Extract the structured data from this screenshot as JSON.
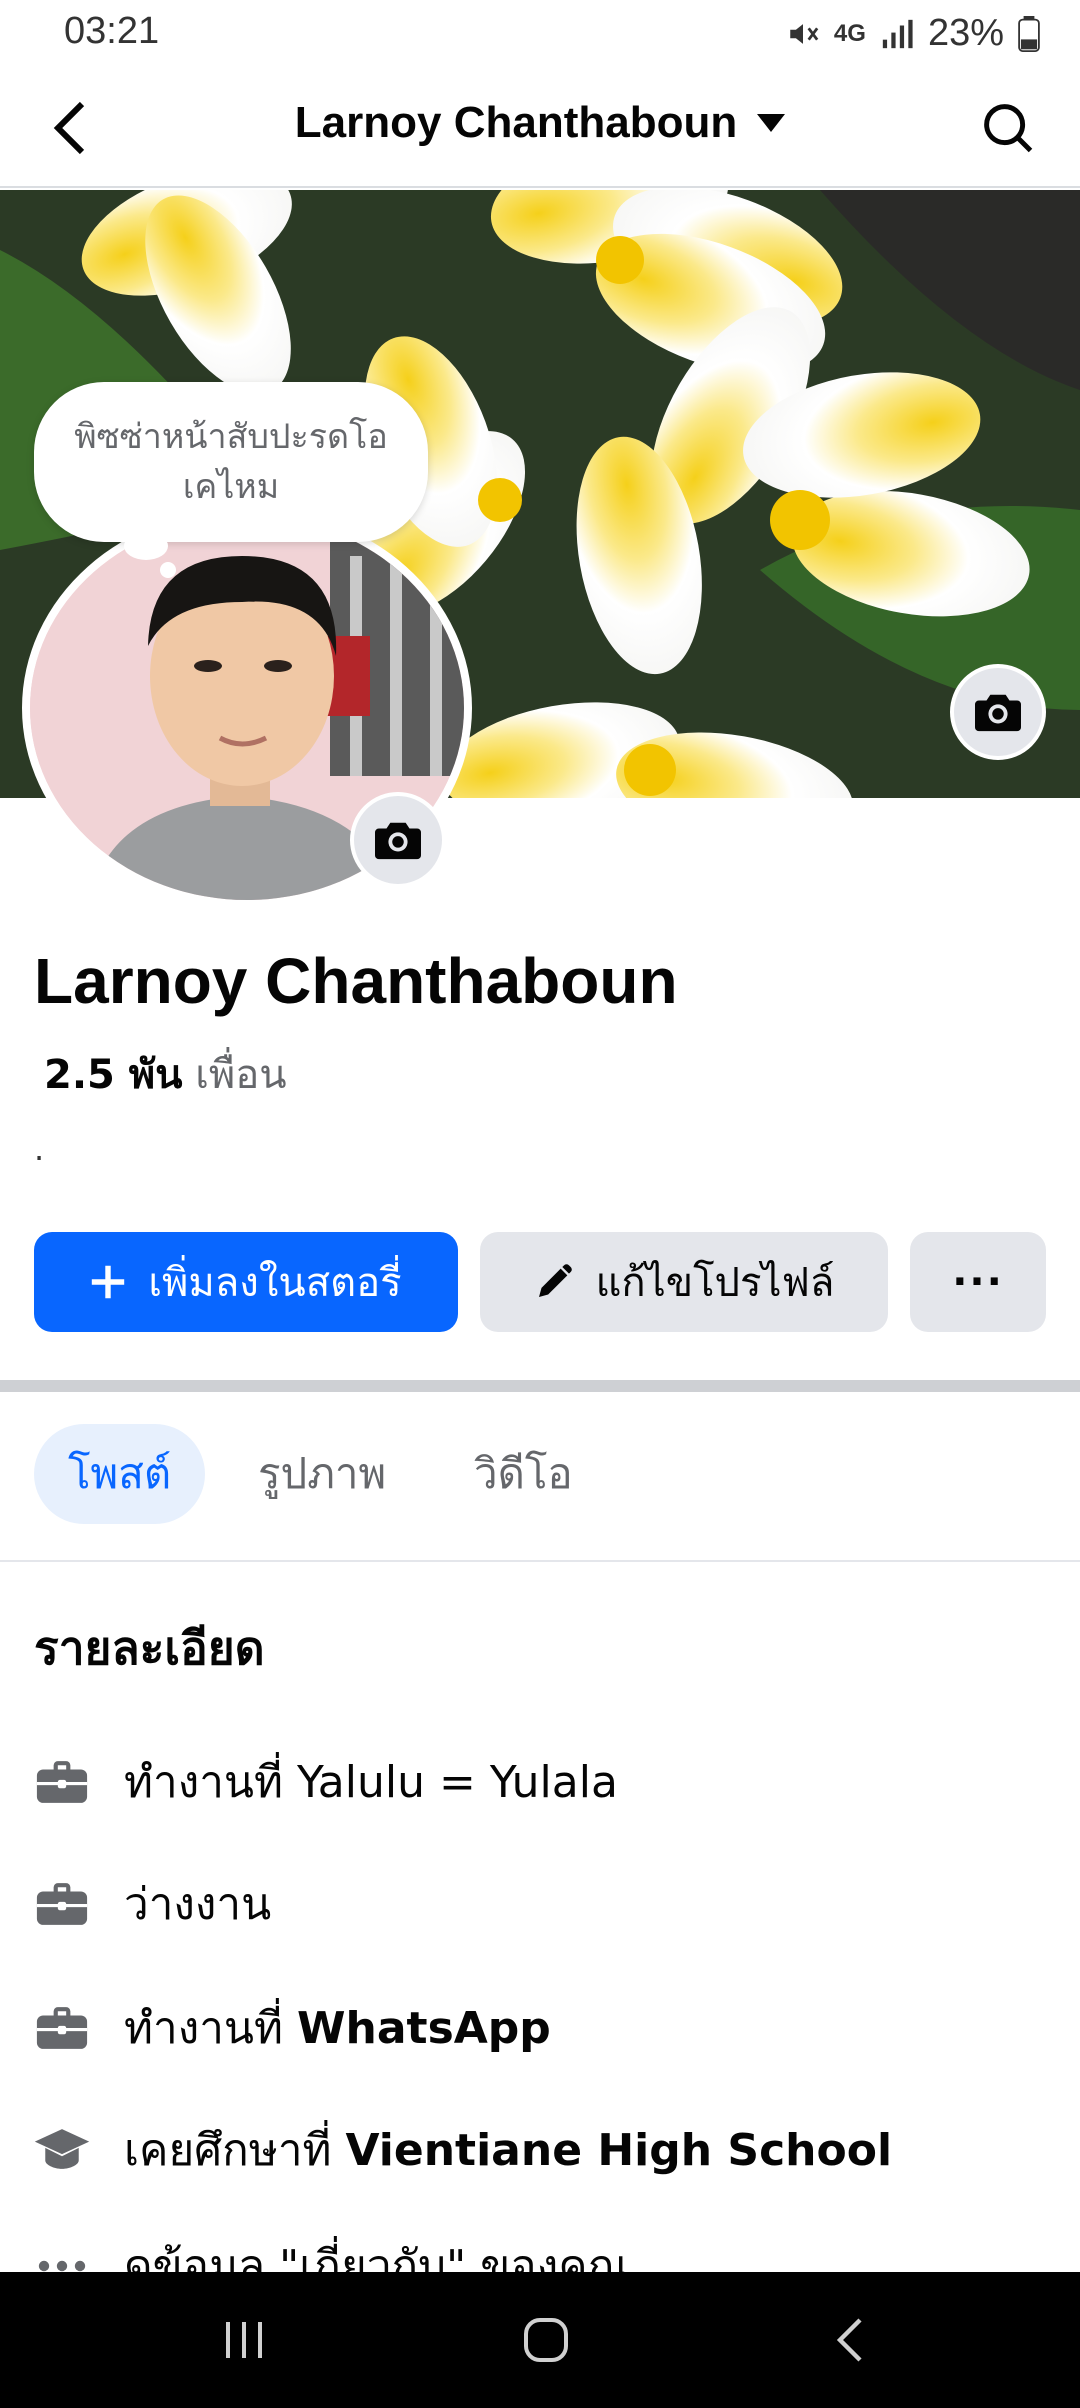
{
  "status_bar": {
    "time": "03:21",
    "network": "4G",
    "battery": "23%"
  },
  "topbar": {
    "title": "Larnoy Chanthaboun"
  },
  "note": {
    "text": "พิซซ่าหน้าสับปะรดโอเคไหม"
  },
  "profile": {
    "name": "Larnoy Chanthaboun",
    "friends_count": "2.5 พัน",
    "friends_label": "เพื่อน",
    "bio": "."
  },
  "actions": {
    "add_story": "เพิ่มลงในสตอรี่",
    "edit_profile": "แก้ไขโปรไฟล์",
    "more": "···"
  },
  "tabs": [
    {
      "label": "โพสต์",
      "active": true
    },
    {
      "label": "รูปภาพ",
      "active": false
    },
    {
      "label": "วิดีโอ",
      "active": false
    }
  ],
  "details": {
    "title": "รายละเอียด",
    "items": [
      {
        "icon": "briefcase-icon",
        "prefix": "ทำงานที่ Yalulu = Yulala",
        "bold": ""
      },
      {
        "icon": "briefcase-icon",
        "prefix": "ว่างงาน",
        "bold": ""
      },
      {
        "icon": "briefcase-icon",
        "prefix": "ทำงานที่ ",
        "bold": "WhatsApp"
      },
      {
        "icon": "graduation-cap-icon",
        "prefix": "เคยศึกษาที่ ",
        "bold": "Vientiane High School"
      },
      {
        "icon": "more-dots-icon",
        "prefix": "ดูข้อมูล \"เกี่ยวกับ\" ของคุณ",
        "bold": ""
      }
    ]
  },
  "colors": {
    "accent": "#0866ff",
    "tab_active_bg": "#e7f0fd",
    "button_grey": "#e4e6eb"
  }
}
